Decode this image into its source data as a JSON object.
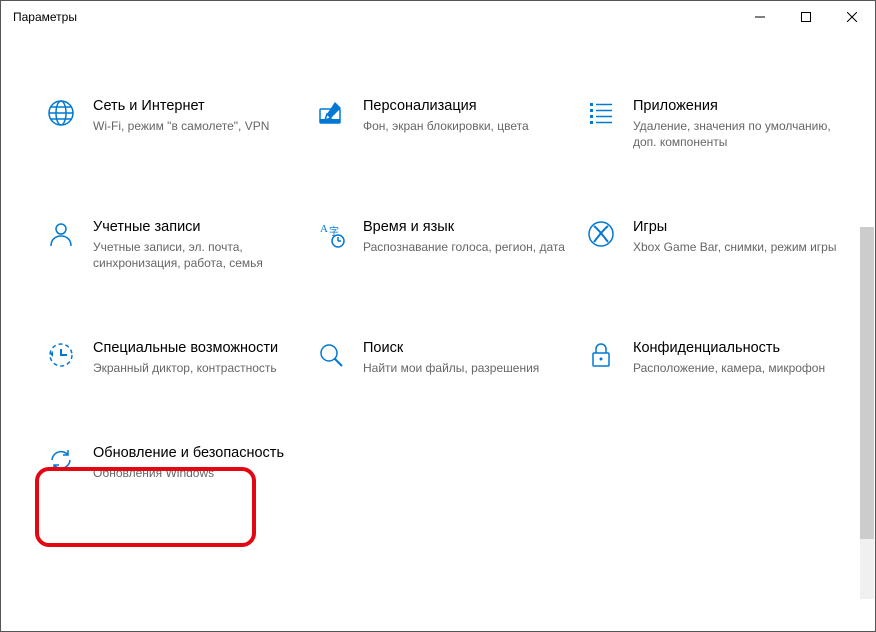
{
  "window": {
    "title": "Параметры"
  },
  "tiles": [
    {
      "title": "Сеть и Интернет",
      "desc": "Wi-Fi, режим \"в самолете\", VPN"
    },
    {
      "title": "Персонализация",
      "desc": "Фон, экран блокировки, цвета"
    },
    {
      "title": "Приложения",
      "desc": "Удаление, значения по умолчанию, доп. компоненты"
    },
    {
      "title": "Учетные записи",
      "desc": "Учетные записи, эл. почта, синхронизация, работа, семья"
    },
    {
      "title": "Время и язык",
      "desc": "Распознавание голоса, регион, дата"
    },
    {
      "title": "Игры",
      "desc": "Xbox Game Bar, снимки, режим игры"
    },
    {
      "title": "Специальные возможности",
      "desc": "Экранный диктор, контрастность"
    },
    {
      "title": "Поиск",
      "desc": "Найти мои файлы, разрешения"
    },
    {
      "title": "Конфиденциальность",
      "desc": "Расположение, камера, микрофон"
    },
    {
      "title": "Обновление и безопасность",
      "desc": "Обновления Windows"
    }
  ]
}
